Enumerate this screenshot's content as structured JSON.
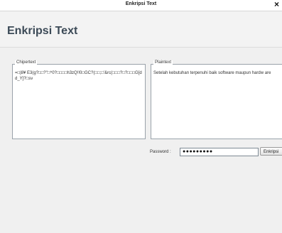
{
  "window": {
    "title": "Enkripsi Text",
    "close_glyph": "×"
  },
  "header": {
    "heading": "Enkripsi Text"
  },
  "cipher": {
    "legend": "Chipertext",
    "text": "=□|8¥ E3(g?□□?\"□^0?□□□□h3zQ!!0□GC?(□□;□'&rc(□□□?□?□□□G[dd_Y]?□sv"
  },
  "plain": {
    "legend": "Plaintext",
    "text": "Setelah kebutuhan terpenuhi baik software maupun hardw are"
  },
  "password": {
    "label": "Password :",
    "value": "●●●●●●●●●"
  },
  "button": {
    "label": "Enkripsi"
  }
}
